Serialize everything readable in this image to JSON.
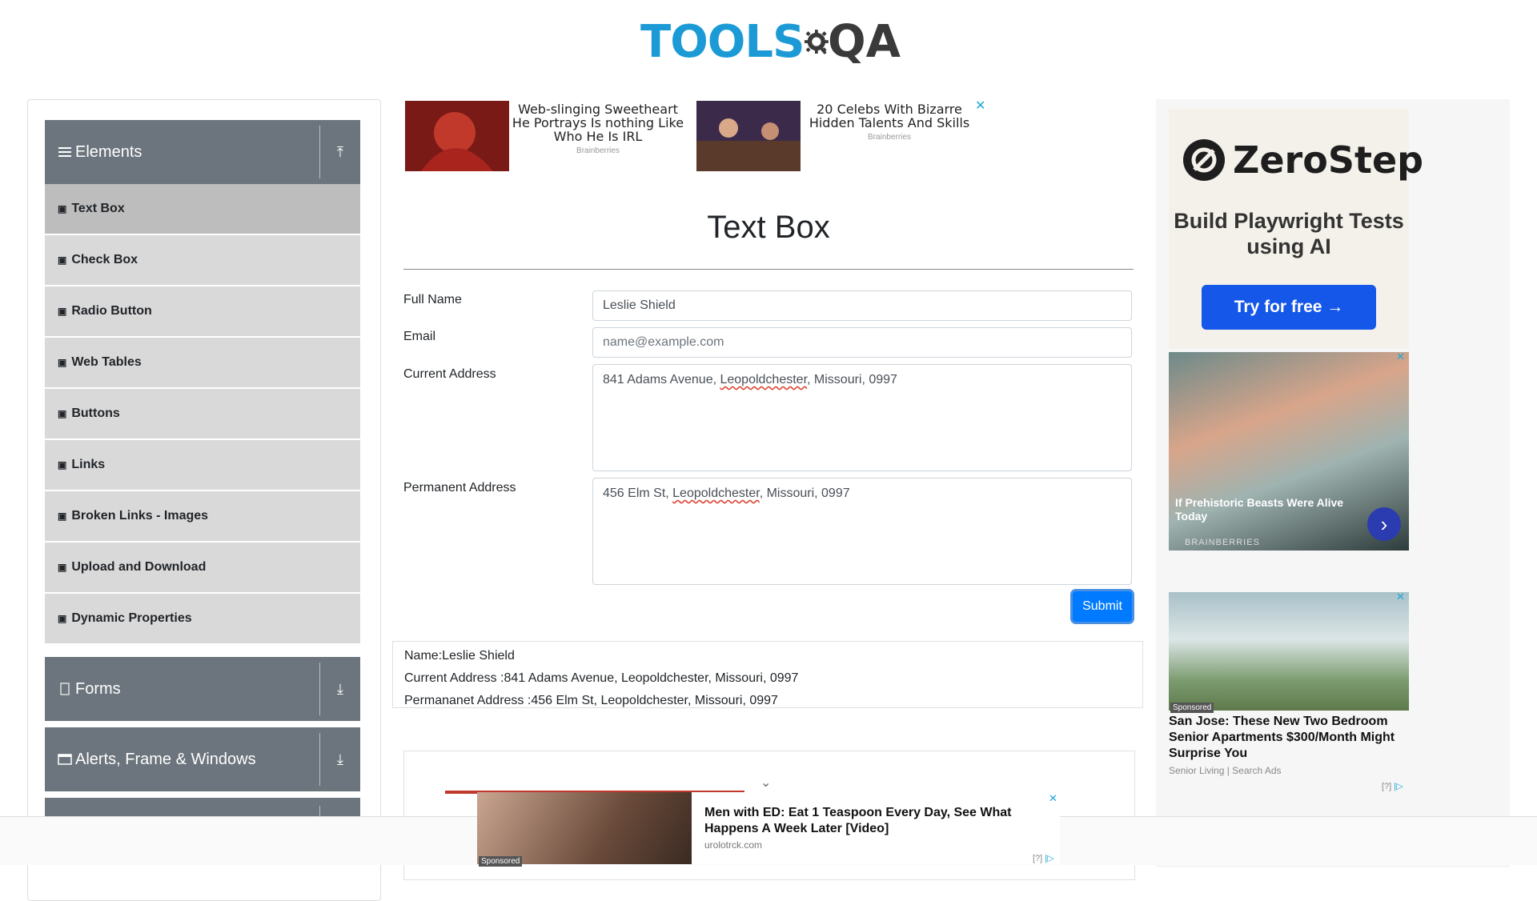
{
  "logo": {
    "tools": "TOOLS",
    "qa": "QA"
  },
  "sidebar": {
    "groups": [
      {
        "label": "Elements",
        "arrow": "⤒"
      },
      {
        "label": "Forms",
        "arrow": "⤓"
      },
      {
        "label": "Alerts, Frame & Windows",
        "arrow": "⤓"
      }
    ],
    "items": [
      {
        "label": "Text Box"
      },
      {
        "label": "Check Box"
      },
      {
        "label": "Radio Button"
      },
      {
        "label": "Web Tables"
      },
      {
        "label": "Buttons"
      },
      {
        "label": "Links"
      },
      {
        "label": "Broken Links - Images"
      },
      {
        "label": "Upload and Download"
      },
      {
        "label": "Dynamic Properties"
      }
    ]
  },
  "top_ads": [
    {
      "caption": "Web-slinging Sweetheart He Portrays Is nothing Like Who He Is IRL",
      "source": "Brainberries"
    },
    {
      "caption": "20 Celebs With Bizarre Hidden Talents And Skills",
      "source": "Brainberries"
    }
  ],
  "form": {
    "title": "Text Box",
    "full_name_label": "Full Name",
    "full_name_value": "Leslie Shield",
    "email_label": "Email",
    "email_placeholder": "name@example.com",
    "current_address_label": "Current Address",
    "current_address_pre": "841 Adams Avenue, ",
    "current_address_city": "Leopoldchester",
    "current_address_post": ", Missouri, 0997",
    "permanent_address_label": "Permanent Address",
    "permanent_address_pre": "456 Elm St, ",
    "permanent_address_city": "Leopoldchester",
    "permanent_address_post": ", Missouri, 0997",
    "submit_label": "Submit"
  },
  "output": {
    "name": "Name:Leslie Shield",
    "current": "Current Address :841 Adams Avenue, Leopoldchester, Missouri, 0997",
    "permanent": "Permananet Address :456 Elm St, Leopoldchester, Missouri, 0997"
  },
  "right_ads": {
    "zerostep": {
      "brand": "ZeroStep",
      "tagline": "Build Playwright Tests using AI",
      "cta": "Try for free →"
    },
    "fly": {
      "caption": "If Prehistoric Beasts Were Alive Today",
      "source": "BRAINBERRIES"
    },
    "house": {
      "badge": "Sponsored",
      "headline": "San Jose: These New Two Bedroom Senior Apartments $300/Month Might Surprise You",
      "source": "Senior Living | Search Ads",
      "info": "[?]"
    }
  },
  "sticky_ad": {
    "badge": "Sponsored",
    "headline": "Men with ED: Eat 1 Teaspoon Every Day, See What Happens A Week Later [Video]",
    "source": "urolotrck.com",
    "info": "[?]"
  },
  "colors": {
    "brand_blue": "#1c9ad6",
    "sidebar_header": "#6c757d",
    "submit": "#007bff"
  }
}
